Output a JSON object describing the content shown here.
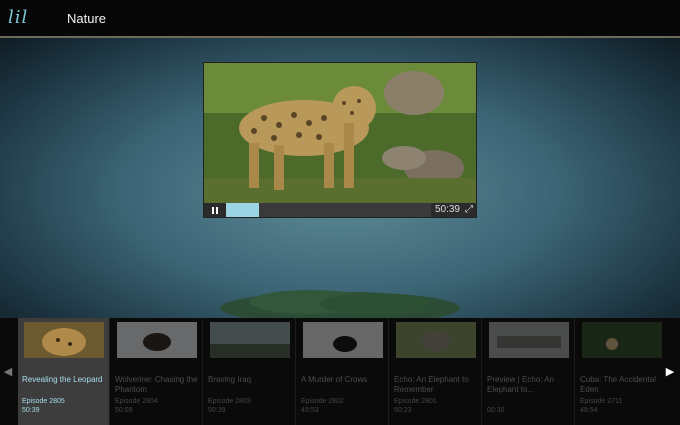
{
  "header": {
    "logo_text": "lil",
    "section_title": "Nature"
  },
  "player": {
    "state": "playing",
    "progress": 0.16,
    "time_display": "50:39"
  },
  "carousel": {
    "episodes": [
      {
        "title": "Revealing the Leopard",
        "episode": "Episode 2805",
        "duration": "50:39",
        "active": true
      },
      {
        "title": "Wolverine: Chasing the Phantom",
        "episode": "Episode 2804",
        "duration": "50:09",
        "active": false
      },
      {
        "title": "Braving Iraq",
        "episode": "Episode 2803",
        "duration": "50:39",
        "active": false
      },
      {
        "title": "A Murder of Crows",
        "episode": "Episode 2802",
        "duration": "49:53",
        "active": false
      },
      {
        "title": "Echo: An Elephant to Remember",
        "episode": "Episode 2801",
        "duration": "50:23",
        "active": false
      },
      {
        "title": "Preview | Echo: An Elephant to...",
        "episode": "",
        "duration": "00:30",
        "active": false
      },
      {
        "title": "Cuba: The Accidental Eden",
        "episode": "Episode 2711",
        "duration": "49:54",
        "active": false
      }
    ]
  },
  "colors": {
    "accent": "#a7dcea",
    "progress_fill": "#9bd5e3"
  }
}
